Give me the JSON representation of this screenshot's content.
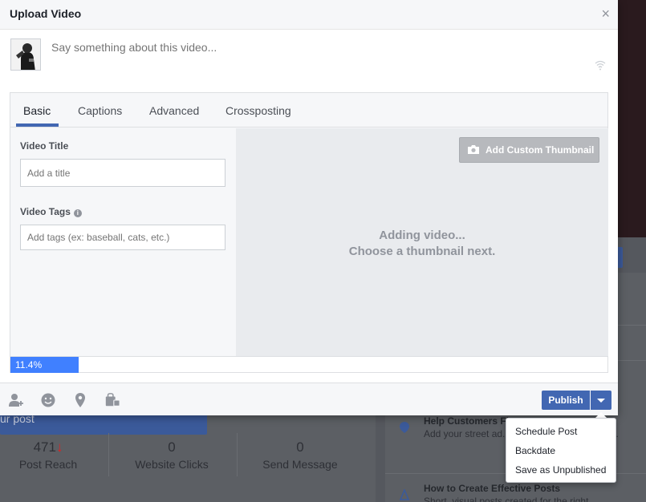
{
  "modal": {
    "title": "Upload Video",
    "close_symbol": "×",
    "composer_placeholder": "Say something about this video..."
  },
  "tabs": [
    {
      "label": "Basic",
      "active": true
    },
    {
      "label": "Captions",
      "active": false
    },
    {
      "label": "Advanced",
      "active": false
    },
    {
      "label": "Crossposting",
      "active": false
    }
  ],
  "form": {
    "title_label": "Video Title",
    "title_placeholder": "Add a title",
    "tags_label": "Video Tags",
    "tags_placeholder": "Add tags (ex: baseball, cats, etc.)"
  },
  "preview": {
    "thumbnail_button": "Add Custom Thumbnail",
    "status_line1": "Adding video...",
    "status_line2": "Choose a thumbnail next."
  },
  "progress": {
    "label": "11.4%",
    "fraction": 0.114
  },
  "footer": {
    "icons": [
      "tag-people-icon",
      "feeling-icon",
      "location-icon",
      "shop-bag-icon"
    ],
    "publish_label": "Publish"
  },
  "publish_menu": {
    "items": [
      "Schedule Post",
      "Backdate",
      "Save as Unpublished"
    ]
  },
  "background": {
    "post_button_partial": "ur post",
    "stats": [
      {
        "value": "471",
        "label": "Post Reach"
      },
      {
        "value": "0",
        "label": "Website Clicks"
      },
      {
        "value": "0",
        "label": "Send Message"
      }
    ],
    "tips": [
      {
        "title": "Help Customers Fi...",
        "body": "Add your street ad... Marketing to help ... you."
      },
      {
        "title": "How to Create Effective Posts",
        "body": "Short, visual posts created for the right"
      }
    ]
  },
  "colors": {
    "accent": "#4267b2",
    "progress": "#4080ff",
    "trend_down": "#e02020"
  }
}
